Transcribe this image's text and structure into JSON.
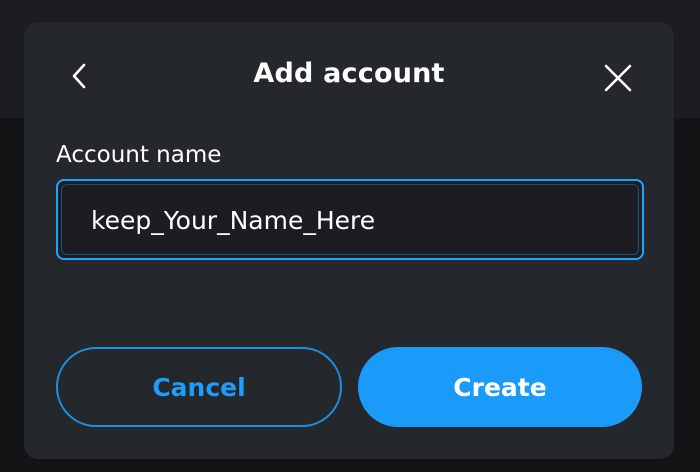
{
  "dialog": {
    "title": "Add account",
    "back_icon": "chevron-left-icon",
    "close_icon": "close-icon"
  },
  "form": {
    "account_name_label": "Account name",
    "account_name_value": "keep_Your_Name_Here"
  },
  "actions": {
    "cancel_label": "Cancel",
    "create_label": "Create"
  },
  "colors": {
    "dialog_bg": "#24272b",
    "accent": "#1a9bfa",
    "text": "#ffffff"
  }
}
